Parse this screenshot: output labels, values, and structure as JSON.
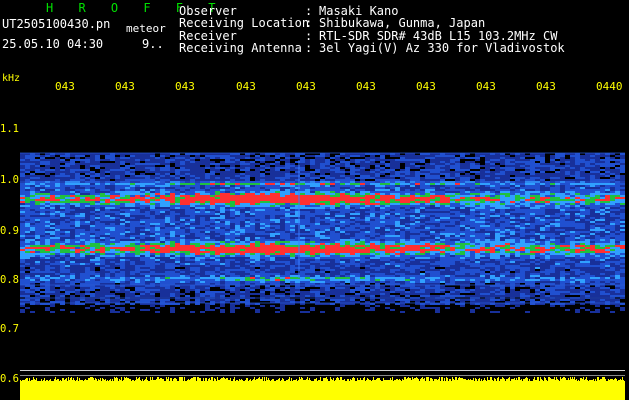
{
  "header": {
    "brand": "H R O F F T",
    "filename": "UT2505100430.pn",
    "mode": "meteor",
    "datetime": "25.05.10 04:30",
    "extra": "9.."
  },
  "info": [
    {
      "label": "Observer",
      "sep": ":",
      "value": "Masaki Kano"
    },
    {
      "label": "Receiving Location",
      "sep": ":",
      "value": "Shibukawa, Gunma, Japan"
    },
    {
      "label": "Receiver",
      "sep": ":",
      "value": "RTL-SDR SDR# 43dB L15 103.2MHz CW"
    },
    {
      "label": "Receiving Antenna",
      "sep": ":",
      "value": "3el Yagi(V) Az 330 for Vladivostok"
    }
  ],
  "axis": {
    "y_unit": "kHz",
    "x_ticks": [
      "043",
      "043",
      "043",
      "043",
      "043",
      "043",
      "043",
      "043",
      "043",
      "0440"
    ],
    "y_ticks": [
      "1.1",
      "1.0",
      "0.9",
      "0.8",
      "0.7",
      "0.6"
    ]
  },
  "colors": {
    "brand": "#00e000",
    "text": "#ffffff",
    "axis": "#ffff00",
    "background": "#000000"
  }
}
